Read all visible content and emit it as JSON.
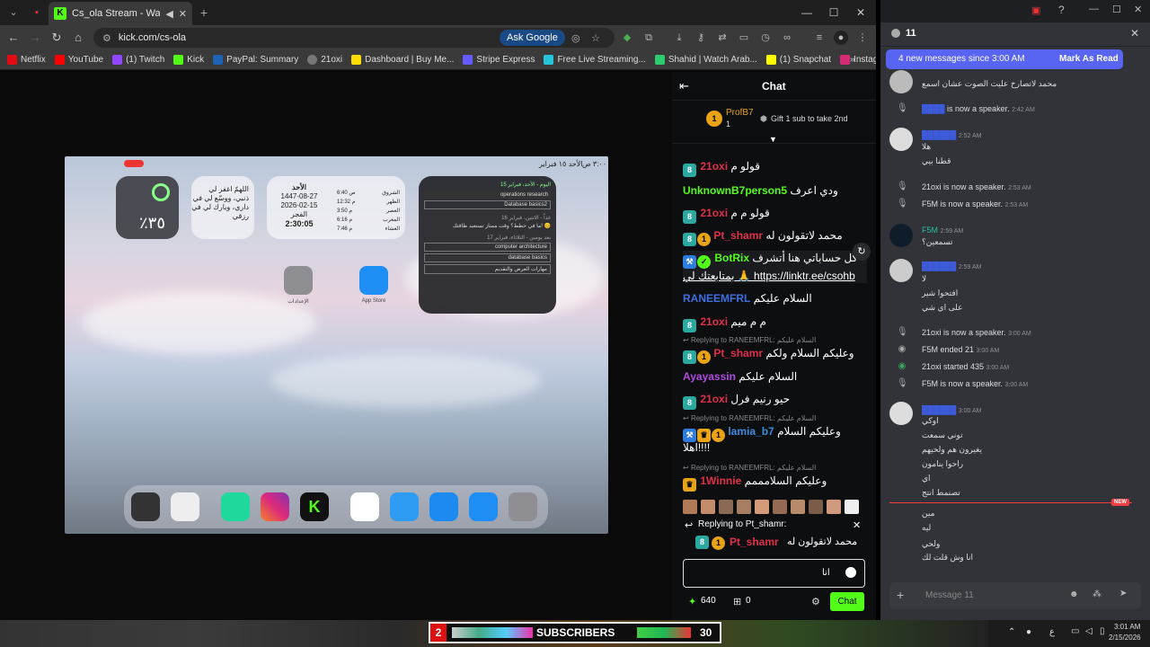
{
  "browser": {
    "tab_title": "Cs_ola Stream - Watch Live",
    "url": "kick.com/cs-ola",
    "ask_google": "Ask Google",
    "bookmarks": [
      "Netflix",
      "YouTube",
      "(1) Twitch",
      "Kick",
      "PayPal: Summary",
      "21oxi",
      "Dashboard | Buy Me...",
      "Stripe Express",
      "Free Live Streaming...",
      "Shahid | Watch Arab...",
      "(1) Snapchat",
      "Instagram"
    ]
  },
  "stream": {
    "status_time": "٣:٠٠ ص",
    "status_date": "الأحد ١٥ فبراير",
    "battery_pct": "٪٣٥",
    "dua_line1": "اللهمّ اغفر لي",
    "dua_line2": "ذنبي، ووسّع لي في",
    "dua_line3": "داري، وبارك لي في",
    "dua_line4": "رزقي",
    "cal_day": "الأحد",
    "cal_hijri": "1447-08-27",
    "cal_greg": "2026-02-15",
    "cal_prayer": "الفجر",
    "cal_time": "2:30:05",
    "prayers": [
      {
        "name": "الشروق",
        "time": "6:40 ص"
      },
      {
        "name": "الظهر",
        "time": "12:32 م"
      },
      {
        "name": "العصر",
        "time": "3:50 م"
      },
      {
        "name": "المغرب",
        "time": "6:16 م"
      },
      {
        "name": "العشاء",
        "time": "7:46 م"
      }
    ],
    "schedule_header": "اليوم - الأحد، فبراير 15",
    "schedule_items": [
      "operations research",
      "Database basics2"
    ],
    "schedule_header2": "غداً - الاثنين، فبراير 16",
    "schedule_note": "ما في خطط؟ وقت ممتاز تستعيد طاقتك! 😊",
    "schedule_header3": "بعد يومين - الثلاثاء، فبراير 17",
    "schedule_items2": [
      "computer architecture",
      "database basics",
      "مهارات العرض والتقديم"
    ],
    "app_settings": "الإعدادات",
    "app_store": "App Store"
  },
  "chat": {
    "title": "Chat",
    "pinned_user": "ProfB7",
    "pinned_count": "1",
    "gift_text": "Gift 1 sub to take 2nd",
    "messages": [
      {
        "user": "21oxi",
        "text": "قولو م",
        "color": "#e0304a"
      },
      {
        "user": "UnknownB7person5",
        "text": "ودي اعرف",
        "color": "#53fc18"
      },
      {
        "user": "21oxi",
        "text": "قولو م م",
        "color": "#e0304a"
      },
      {
        "user": "Pt_shamr",
        "text": "محمد لاتقولون له",
        "color": "#e0304a"
      },
      {
        "user": "BotRix",
        "text": "كل حساباتي هنا أتشرف",
        "color": "#53fc18"
      },
      {
        "user": "",
        "text": "بمتابعتك لي 🙏 https://linktr.ee/csohb",
        "color": "#fff"
      },
      {
        "user": "RANEEMFRL",
        "text": "السلام عليكم",
        "color": "#3d6ee0"
      },
      {
        "user": "21oxi",
        "text": "م م ميم",
        "color": "#e0304a"
      },
      {
        "user": "Pt_shamr",
        "text": "وعليكم السلام ولكم",
        "color": "#e0304a"
      },
      {
        "user": "Ayayassin",
        "text": "السلام عليكم",
        "color": "#b04de0"
      },
      {
        "user": "21oxi",
        "text": "حيو رنيم فرل",
        "color": "#e0304a"
      },
      {
        "user": "lamia_b7",
        "text": "وعليكم السلام",
        "color": "#3d8ee0"
      },
      {
        "user": "",
        "text": "اهلا!!!!",
        "color": "#fff"
      },
      {
        "user": "1Winnie",
        "text": "وعليكم السلامممم",
        "color": "#e0304a"
      }
    ],
    "reply_to_raneem": "Replying to RANEEMFRL:",
    "reply_to_raneem_text": "السلام عليكم",
    "replying_label": "Replying to Pt_shamr:",
    "reply_user": "Pt_shamr",
    "reply_text": "محمد لاتقولون له",
    "input_value": "انا",
    "points": "640",
    "drops": "0",
    "chat_button": "Chat"
  },
  "discord": {
    "channel_count": "11",
    "banner_text": "4 new messages since 3:00 AM",
    "mark_read": "Mark As Read",
    "input_placeholder": "Message 11",
    "new_label": "NEW",
    "lines": [
      {
        "t": "محمد لاتصارخ عليت الصوت عشان اسمع"
      },
      {
        "t": "is now a speaker.",
        "ts": "2:42 AM"
      },
      {
        "t": "هلا",
        "ts": "2:52 AM"
      },
      {
        "t": "قطنا بيي"
      },
      {
        "t": "21oxi is now a speaker.",
        "ts": "2:53 AM"
      },
      {
        "t": "F5M is now a speaker.",
        "ts": "2:53 AM"
      },
      {
        "t": "F5M",
        "ts": "2:59 AM"
      },
      {
        "t": "تسمعين؟"
      },
      {
        "t": "",
        "ts": "2:59 AM"
      },
      {
        "t": "لا"
      },
      {
        "t": "افتحوا شير"
      },
      {
        "t": "على اي شي"
      },
      {
        "t": "21oxi is now a speaker.",
        "ts": "3:00 AM"
      },
      {
        "t": "F5M ended 21",
        "ts": "3:00 AM"
      },
      {
        "t": "21oxi started 435",
        "ts": "3:00 AM"
      },
      {
        "t": "F5M is now a speaker.",
        "ts": "3:00 AM"
      },
      {
        "t": "",
        "ts": "3:00 AM"
      },
      {
        "t": "اوكي"
      },
      {
        "t": "توني سمعت"
      },
      {
        "t": "يغيرون هم ولحيهم"
      },
      {
        "t": "راحوا ينامون"
      },
      {
        "t": "اي"
      },
      {
        "t": "تصنمط انتج"
      },
      {
        "t": "مين"
      },
      {
        "t": "ليه"
      },
      {
        "t": "ولحي"
      },
      {
        "t": "انا وش قلت لك"
      }
    ]
  },
  "taskbar": {
    "subs_left": "2",
    "subs_label": "SUBSCRIBERS",
    "subs_right": "30",
    "time": "3:01 AM",
    "date": "2/15/2026"
  }
}
